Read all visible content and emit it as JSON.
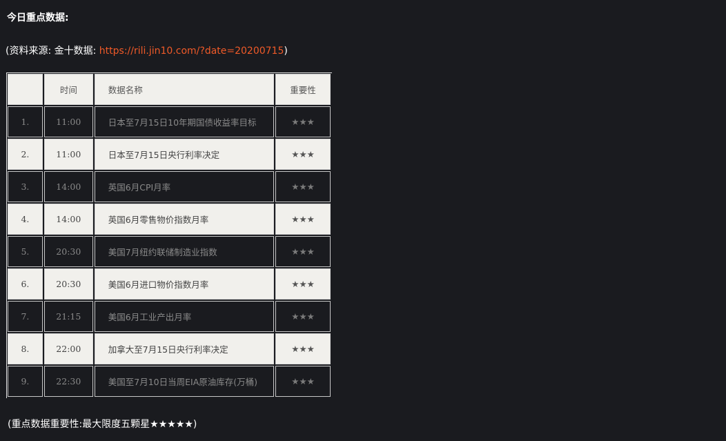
{
  "heading": "今日重点数据:",
  "source": {
    "prefix": "(资料来源: 金十数据: ",
    "link": "https://rili.jin10.com/?date=20200715",
    "suffix": ")"
  },
  "table": {
    "headers": [
      "",
      "时间",
      "数据名称",
      "重要性"
    ],
    "rows": [
      {
        "idx": "1.",
        "time": "11:00",
        "name": "日本至7月15日10年期国债收益率目标",
        "stars": "★★★"
      },
      {
        "idx": "2.",
        "time": "11:00",
        "name": "日本至7月15日央行利率决定",
        "stars": "★★★"
      },
      {
        "idx": "3.",
        "time": "14:00",
        "name": "英国6月CPI月率",
        "stars": "★★★"
      },
      {
        "idx": "4.",
        "time": "14:00",
        "name": "英国6月零售物价指数月率",
        "stars": "★★★"
      },
      {
        "idx": "5.",
        "time": "20:30",
        "name": "美国7月纽约联储制造业指数",
        "stars": "★★★"
      },
      {
        "idx": "6.",
        "time": "20:30",
        "name": "美国6月进口物价指数月率",
        "stars": "★★★"
      },
      {
        "idx": "7.",
        "time": "21:15",
        "name": "美国6月工业产出月率",
        "stars": "★★★"
      },
      {
        "idx": "8.",
        "time": "22:00",
        "name": "加拿大至7月15日央行利率决定",
        "stars": "★★★"
      },
      {
        "idx": "9.",
        "time": "22:30",
        "name": "美国至7月10日当周EIA原油库存(万桶)",
        "stars": "★★★"
      }
    ]
  },
  "footer": "(重点数据重要性:最大限度五颗星★★★★★)"
}
